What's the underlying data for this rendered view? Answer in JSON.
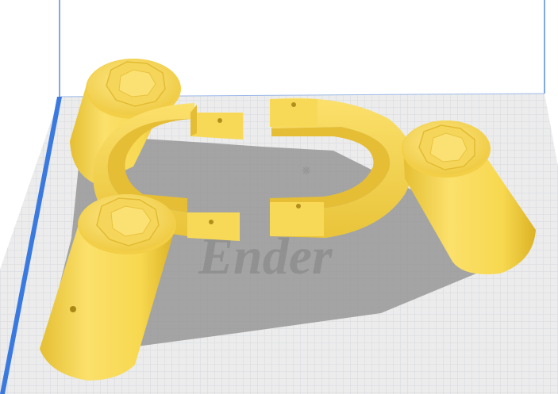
{
  "viewport": {
    "watermark": "Ender"
  },
  "colors": {
    "background": "#ffffff",
    "build_plate": "#ededed",
    "grid_line": "#cfd3d9",
    "volume_edge": "#3f7fe0",
    "model_light": "#fbe06b",
    "model_mid": "#f5d44e",
    "model_dark": "#e0b82a",
    "model_shadow": "#7a7a7a"
  },
  "icons": [
    "build-plate",
    "build-volume-edge",
    "printer-logo-watermark",
    "3d-model-part"
  ]
}
